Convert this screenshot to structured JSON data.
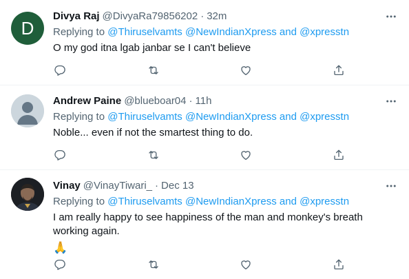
{
  "tweets": [
    {
      "avatar_letter": "D",
      "avatar_color": "#1f5e3a",
      "name": "Divya Raj",
      "handle": "@DivyaRa79856202",
      "time": "32m",
      "reply_prefix": "Replying to",
      "mentions": "@Thiruselvamts @NewIndianXpress and @xpresstn",
      "text": "O my god itna lgab janbar se I can't believe",
      "emoji": ""
    },
    {
      "avatar_letter": "",
      "avatar_color": "#ccd6dd",
      "name": "Andrew Paine",
      "handle": "@blueboar04",
      "time": "11h",
      "reply_prefix": "Replying to",
      "mentions": "@Thiruselvamts @NewIndianXpress and @xpresstn",
      "text": "Noble... even if not the smartest thing to do.",
      "emoji": ""
    },
    {
      "avatar_letter": "",
      "avatar_color": "#1c1f24",
      "name": "Vinay",
      "handle": "@VinayTiwari_",
      "time": "Dec 13",
      "reply_prefix": "Replying to",
      "mentions": "@Thiruselvamts @NewIndianXpress and @xpresstn",
      "text": "I am really happy to see happiness of the man and monkey's breath working again.",
      "emoji": "🙏"
    }
  ],
  "separator": "·",
  "icons": {
    "more": "more-horizontal-icon",
    "reply": "reply-icon",
    "retweet": "retweet-icon",
    "like": "heart-icon",
    "share": "share-icon"
  },
  "colors": {
    "link": "#1d9bf0",
    "secondary": "#536471",
    "primary": "#0f1419"
  }
}
